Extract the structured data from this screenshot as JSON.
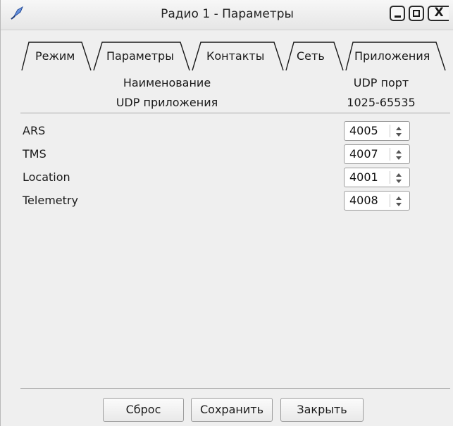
{
  "window": {
    "title": "Радио 1 - Параметры",
    "min_glyph": "",
    "close_glyph": "X"
  },
  "tabs": [
    {
      "label": "Режим"
    },
    {
      "label": "Параметры"
    },
    {
      "label": "Контакты"
    },
    {
      "label": "Сеть"
    },
    {
      "label": "Приложения",
      "active": true
    }
  ],
  "table": {
    "col1_line1": "Наименование",
    "col1_line2": "UDP приложения",
    "col2_line1": "UDP порт",
    "col2_line2": "1025-65535",
    "rows": [
      {
        "name": "ARS",
        "port": "4005"
      },
      {
        "name": "TMS",
        "port": "4007"
      },
      {
        "name": "Location",
        "port": "4001"
      },
      {
        "name": "Telemetry",
        "port": "4008"
      }
    ]
  },
  "buttons": {
    "reset": "Сброс",
    "save": "Сохранить",
    "close": "Закрыть"
  }
}
